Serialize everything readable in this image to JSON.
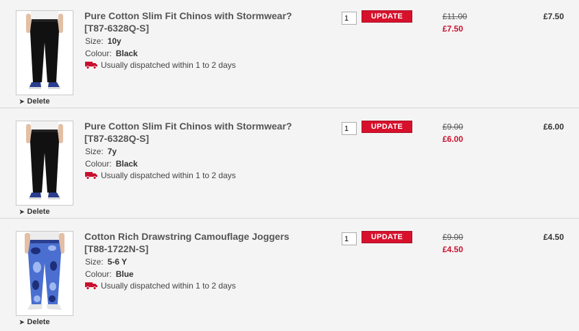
{
  "items": [
    {
      "title": "Pure Cotton Slim Fit Chinos with Stormwear?",
      "code": "[T87-6328Q-S]",
      "size_label": "Size:",
      "size": "10y",
      "colour_label": "Colour:",
      "colour": "Black",
      "dispatch": "Usually dispatched within 1 to 2 days",
      "quantity": "1",
      "update_label": "UPDATE",
      "was_price": "£11.00",
      "now_price": "£7.50",
      "total": "£7.50",
      "delete_label": "Delete",
      "image": "black-chinos"
    },
    {
      "title": "Pure Cotton Slim Fit Chinos with Stormwear?",
      "code": "[T87-6328Q-S]",
      "size_label": "Size:",
      "size": "7y",
      "colour_label": "Colour:",
      "colour": "Black",
      "dispatch": "Usually dispatched within 1 to 2 days",
      "quantity": "1",
      "update_label": "UPDATE",
      "was_price": "£9.00",
      "now_price": "£6.00",
      "total": "£6.00",
      "delete_label": "Delete",
      "image": "black-chinos"
    },
    {
      "title": "Cotton Rich Drawstring Camouflage Joggers",
      "code": "[T88-1722N-S]",
      "size_label": "Size:",
      "size": "5-6 Y",
      "colour_label": "Colour:",
      "colour": "Blue",
      "dispatch": "Usually dispatched within 1 to 2 days",
      "quantity": "1",
      "update_label": "UPDATE",
      "was_price": "£9.00",
      "now_price": "£4.50",
      "total": "£4.50",
      "delete_label": "Delete",
      "image": "blue-camo-joggers"
    }
  ],
  "colors": {
    "accent": "#d7112c",
    "sale_price": "#c8102e",
    "background": "#f4f4f4"
  }
}
